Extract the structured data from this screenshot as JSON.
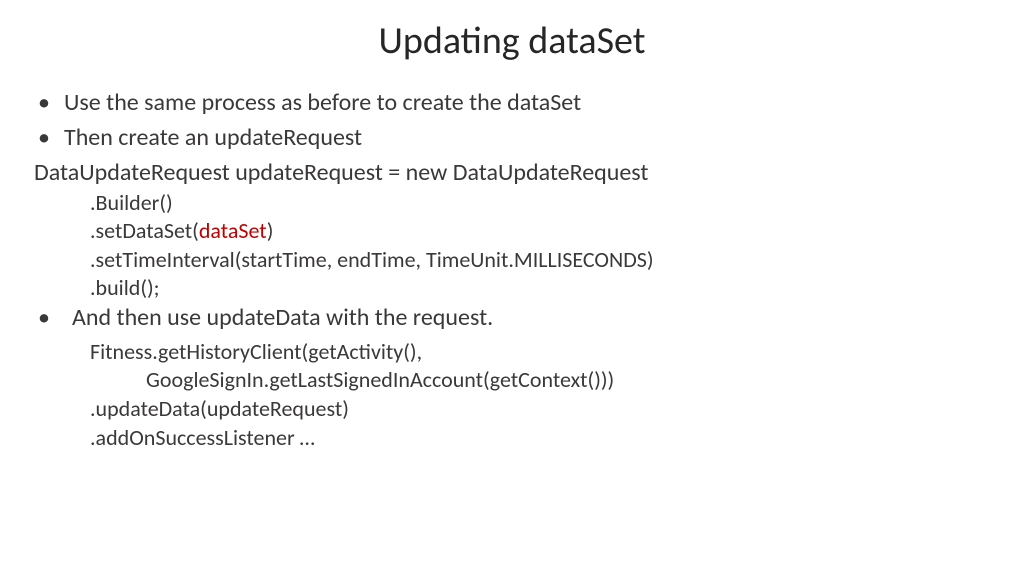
{
  "title": "Updating dataSet",
  "bullet1": "Use the same process as before to create the dataSet",
  "bullet2": "Then create an updateRequest",
  "code1_line1": "DataUpdateRequest updateRequest = new DataUpdateRequest",
  "code1_line2": ".Builder()",
  "code1_line3_a": ".setDataSet(",
  "code1_line3_b": "dataSet",
  "code1_line3_c": ")",
  "code1_line4": ".setTimeInterval(startTime, endTime, TimeUnit.MILLISECONDS)",
  "code1_line5": ".build();",
  "bullet3": "And then use updateData with the request.",
  "code2_line1": "Fitness.getHistoryClient(getActivity(),",
  "code2_line2": "GoogleSignIn.getLastSignedInAccount(getContext()))",
  "code2_line3": ".updateData(updateRequest)",
  "code2_line4": ".addOnSuccessListener …"
}
